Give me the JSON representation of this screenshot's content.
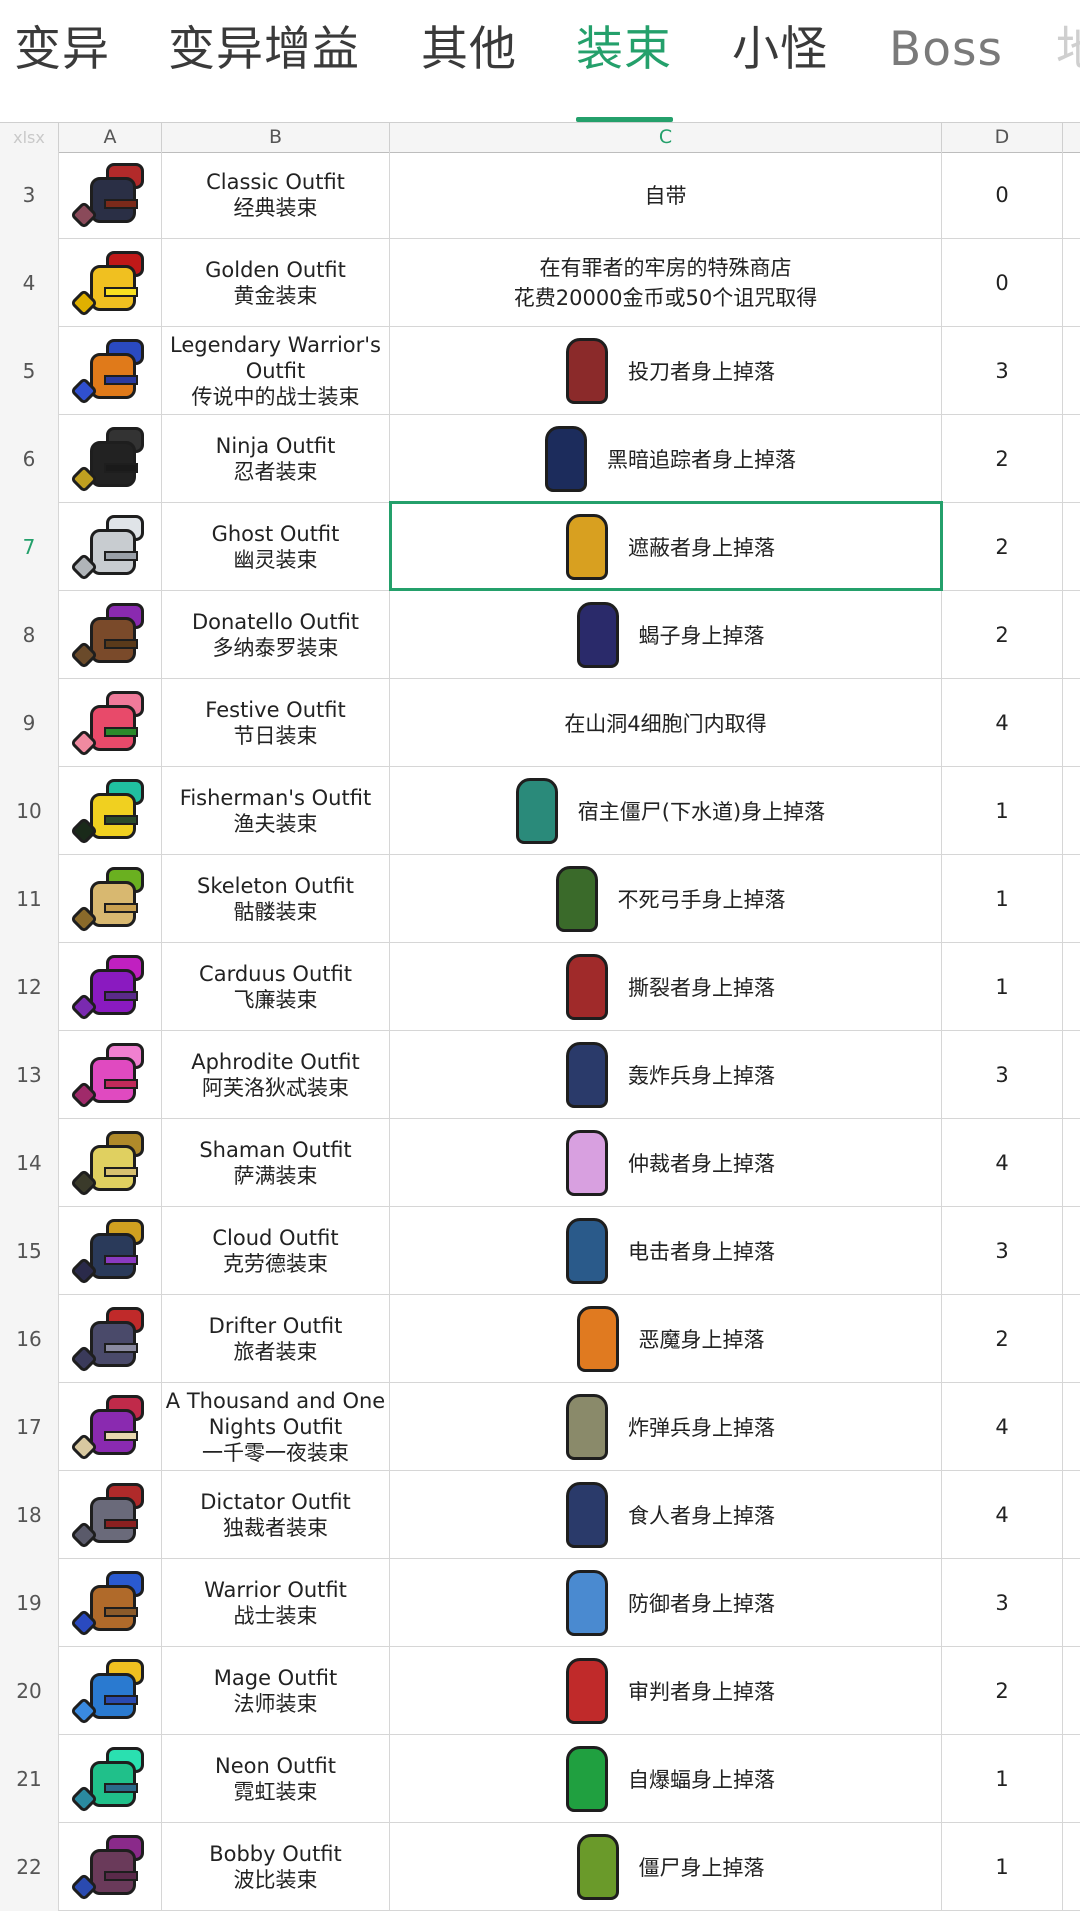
{
  "tabs": [
    {
      "label": "变异",
      "state": "normal"
    },
    {
      "label": "变异增益",
      "state": "normal"
    },
    {
      "label": "其他",
      "state": "normal"
    },
    {
      "label": "装束",
      "state": "active"
    },
    {
      "label": "小怪",
      "state": "normal"
    },
    {
      "label": "Boss",
      "state": "dim"
    },
    {
      "label": "地",
      "state": "faded"
    }
  ],
  "sheet": {
    "corner_label": "xlsx",
    "columns": [
      "A",
      "B",
      "C",
      "D"
    ],
    "active_column": "C",
    "selected_row": "7",
    "rows": [
      {
        "num": "3",
        "en": "Classic Outfit",
        "cn": "经典装束",
        "source": "自带",
        "value": "0",
        "colors": [
          "#2a2f45",
          "#b22a2a",
          "#7b2a1a",
          "#8a4a5a"
        ],
        "sprite": null
      },
      {
        "num": "4",
        "en": "Golden Outfit",
        "cn": "黄金装束",
        "source": "在有罪者的牢房的特殊商店",
        "source2": "花费20000金币或50个诅咒取得",
        "value": "0",
        "colors": [
          "#f0c020",
          "#c01818",
          "#f8e020",
          "#e0b000"
        ],
        "sprite": null
      },
      {
        "num": "5",
        "en": "Legendary Warrior's",
        "en2": "Outfit",
        "cn": "传说中的战士装束",
        "source": "投刀者身上掉落",
        "value": "3",
        "colors": [
          "#e07a1a",
          "#2a4ac0",
          "#2a3aa0",
          "#3050d0"
        ],
        "sprite": "#8b2a2a"
      },
      {
        "num": "6",
        "en": "Ninja Outfit",
        "cn": "忍者装束",
        "source": "黑暗追踪者身上掉落",
        "value": "2",
        "colors": [
          "#222222",
          "#333333",
          "#1a1a1a",
          "#c0a020"
        ],
        "sprite": "#1c2c5c"
      },
      {
        "num": "7",
        "en": "Ghost Outfit",
        "cn": "幽灵装束",
        "source": "遮蔽者身上掉落",
        "value": "2",
        "colors": [
          "#c8ccd0",
          "#e0e4e8",
          "#9aa0a8",
          "#b0b4b8"
        ],
        "sprite": "#d8a020"
      },
      {
        "num": "8",
        "en": "Donatello Outfit",
        "cn": "多纳泰罗装束",
        "source": "蝎子身上掉落",
        "value": "2",
        "colors": [
          "#7a4a2a",
          "#8a2ab0",
          "#5a3a1a",
          "#6a4a2a"
        ],
        "sprite": "#2a2a6a"
      },
      {
        "num": "9",
        "en": "Festive Outfit",
        "cn": "节日装束",
        "source": "在山洞4细胞门内取得",
        "value": "4",
        "colors": [
          "#e84a6a",
          "#f07a9a",
          "#2a8a2a",
          "#f08aa0"
        ],
        "sprite": null
      },
      {
        "num": "10",
        "en": "Fisherman's Outfit",
        "cn": "渔夫装束",
        "source": "宿主僵尸(下水道)身上掉落",
        "value": "1",
        "colors": [
          "#f0d020",
          "#20c0a0",
          "#2a4a2a",
          "#1a2a1a"
        ],
        "sprite": "#2a8a7a"
      },
      {
        "num": "11",
        "en": "Skeleton Outfit",
        "cn": "骷髅装束",
        "source": "不死弓手身上掉落",
        "value": "1",
        "colors": [
          "#d8b870",
          "#6ab020",
          "#c8a050",
          "#8a6a2a"
        ],
        "sprite": "#3a6a2a"
      },
      {
        "num": "12",
        "en": "Carduus Outfit",
        "cn": "飞廉装束",
        "source": "撕裂者身上掉落",
        "value": "1",
        "colors": [
          "#8a1ac0",
          "#c020c0",
          "#5a2a8a",
          "#7a2ab0"
        ],
        "sprite": "#a02a2a"
      },
      {
        "num": "13",
        "en": "Aphrodite Outfit",
        "cn": "阿芙洛狄忒装束",
        "source": "轰炸兵身上掉落",
        "value": "3",
        "colors": [
          "#e04ac0",
          "#f080d0",
          "#c02a5a",
          "#a02a6a"
        ],
        "sprite": "#2a3a6a"
      },
      {
        "num": "14",
        "en": "Shaman Outfit",
        "cn": "萨满装束",
        "source": "仲裁者身上掉落",
        "value": "4",
        "colors": [
          "#e0d060",
          "#b08a2a",
          "#d8c070",
          "#3a3a2a"
        ],
        "sprite": "#d8a0e0"
      },
      {
        "num": "15",
        "en": "Cloud Outfit",
        "cn": "克劳德装束",
        "source": "电击者身上掉落",
        "value": "3",
        "colors": [
          "#2a3a5a",
          "#d0a020",
          "#8a3ac0",
          "#2a2a4a"
        ],
        "sprite": "#2a5a8a"
      },
      {
        "num": "16",
        "en": "Drifter Outfit",
        "cn": "旅者装束",
        "source": "恶魔身上掉落",
        "value": "2",
        "colors": [
          "#4a4a6a",
          "#c02a2a",
          "#8a8aa0",
          "#3a3a5a"
        ],
        "sprite": "#e07a20"
      },
      {
        "num": "17",
        "en": "A Thousand and One",
        "en2": "Nights Outfit",
        "cn": "一千零一夜装束",
        "source": "炸弹兵身上掉落",
        "value": "4",
        "colors": [
          "#8a2ab0",
          "#c02a4a",
          "#e8d8b0",
          "#d8c8a0"
        ],
        "sprite": "#8a8a6a"
      },
      {
        "num": "18",
        "en": "Dictator Outfit",
        "cn": "独裁者装束",
        "source": "食人者身上掉落",
        "value": "4",
        "colors": [
          "#6a6a7a",
          "#b02a2a",
          "#8a2020",
          "#5a5a6a"
        ],
        "sprite": "#2a3a6a"
      },
      {
        "num": "19",
        "en": "Warrior Outfit",
        "cn": "战士装束",
        "source": "防御者身上掉落",
        "value": "3",
        "colors": [
          "#b06a2a",
          "#2a5ad0",
          "#8a5a2a",
          "#2a4ac0"
        ],
        "sprite": "#4a8ad0"
      },
      {
        "num": "20",
        "en": "Mage Outfit",
        "cn": "法师装束",
        "source": "审判者身上掉落",
        "value": "2",
        "colors": [
          "#2a7ad0",
          "#f0c020",
          "#2a4ab0",
          "#3a8ae0"
        ],
        "sprite": "#c02a2a"
      },
      {
        "num": "21",
        "en": "Neon Outfit",
        "cn": "霓虹装束",
        "source": "自爆蝠身上掉落",
        "value": "1",
        "colors": [
          "#20c08a",
          "#2ae0b0",
          "#2a6a8a",
          "#2a8aa0"
        ],
        "sprite": "#20a040"
      },
      {
        "num": "22",
        "en": "Bobby Outfit",
        "cn": "波比装束",
        "source": "僵尸身上掉落",
        "value": "1",
        "colors": [
          "#6a3a5a",
          "#8a2a8a",
          "#5a2a4a",
          "#2a4ab0"
        ],
        "sprite": "#6a9a2a"
      }
    ]
  }
}
